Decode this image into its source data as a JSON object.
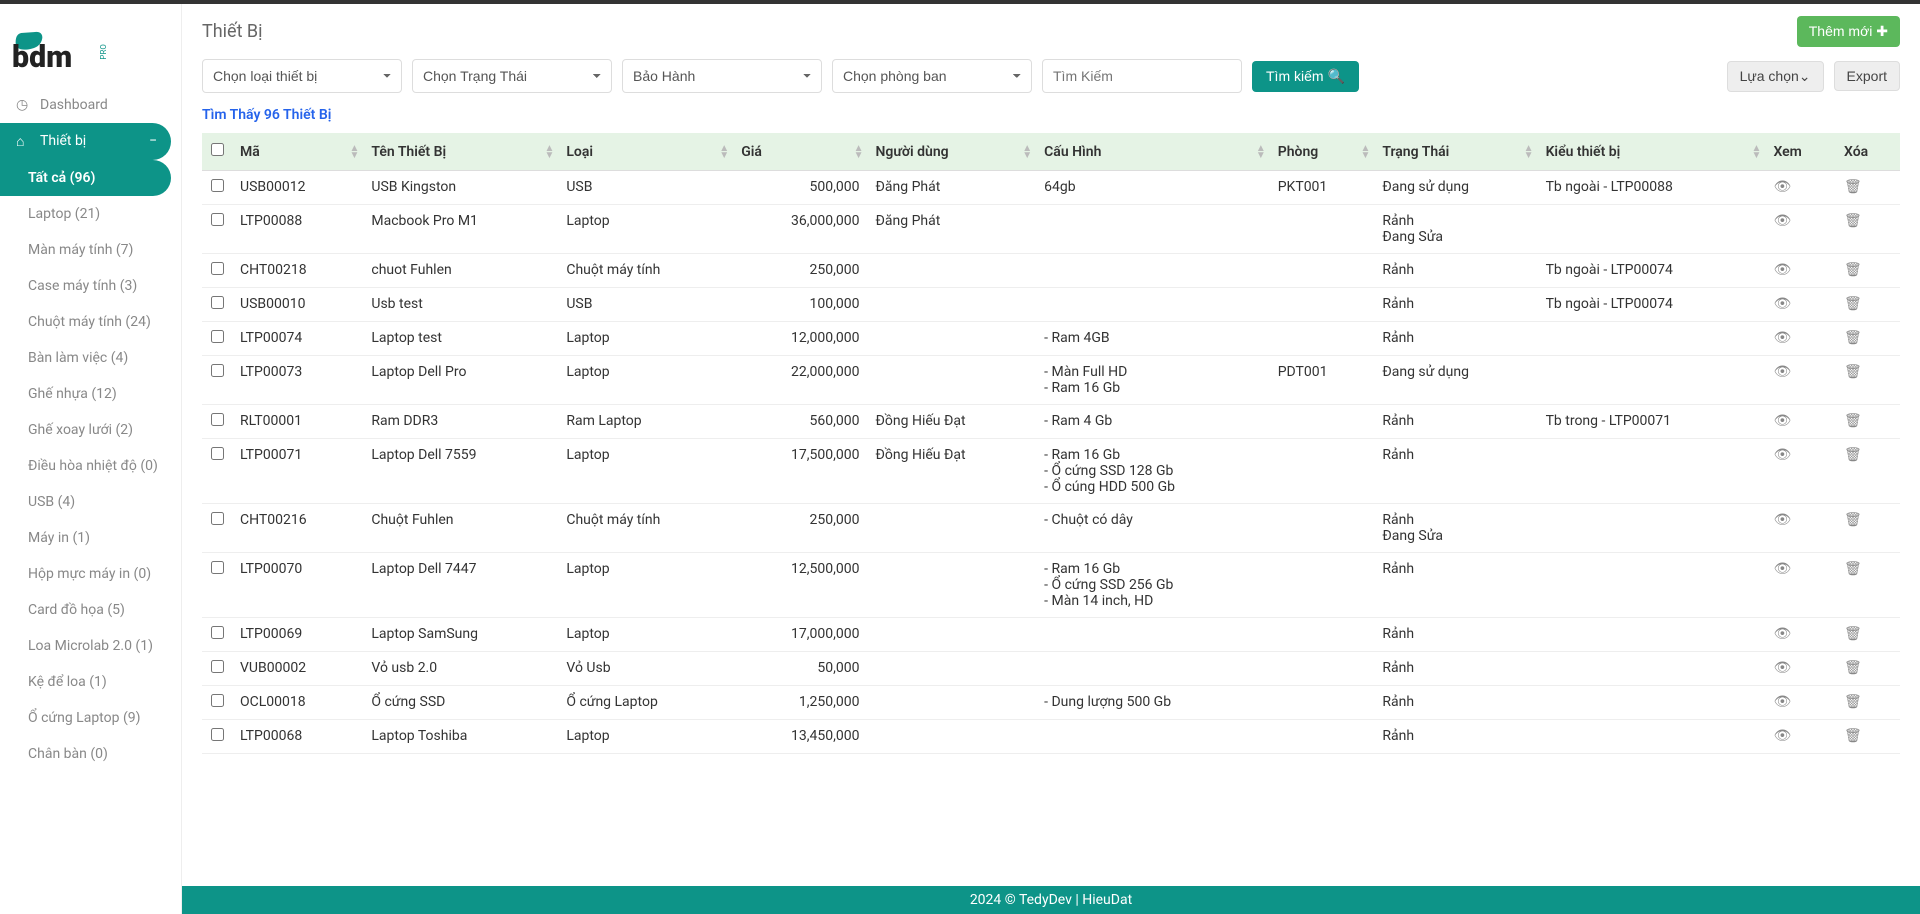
{
  "header": {
    "title": "Thiết Bị",
    "add_button": "Thêm mới "
  },
  "nav": {
    "dashboard": "Dashboard",
    "devices": "Thiết bị",
    "sub": [
      "Tất cả (96)",
      "Laptop (21)",
      "Màn máy tính (7)",
      "Case máy tính (3)",
      "Chuột máy tính (24)",
      "Bàn làm việc (4)",
      "Ghế nhựa (12)",
      "Ghế xoay lưới (2)",
      "Điều hòa nhiệt độ (0)",
      "USB (4)",
      "Máy in (1)",
      "Hộp mực máy in (0)",
      "Card đồ họa (5)",
      "Loa Microlab 2.0 (1)",
      "Kệ để loa (1)",
      "Ổ cứng Laptop (9)",
      "Chân bàn (0)"
    ]
  },
  "filters": {
    "type_placeholder": "Chọn loại thiết bị",
    "status_placeholder": "Chọn Trạng Thái",
    "warranty_placeholder": "Bảo Hành",
    "dept_placeholder": "Chọn phòng ban",
    "search_placeholder": "Tìm Kiếm",
    "search_btn": "Tìm kiếm ",
    "option_btn": "Lựa chọn",
    "export_btn": "Export"
  },
  "found_text": "Tìm Thấy 96 Thiết Bị",
  "columns": {
    "code": "Mã",
    "name": "Tên Thiết Bị",
    "type": "Loại",
    "price": "Giá",
    "user": "Người dùng",
    "config": "Cấu Hình",
    "room": "Phòng",
    "status": "Trạng Thái",
    "kind": "Kiểu thiết bị",
    "view": "Xem",
    "delete": "Xóa"
  },
  "rows": [
    {
      "code": "USB00012",
      "name": "USB Kingston",
      "type": "USB",
      "price": "500,000",
      "user": "Đăng Phát",
      "config": "64gb",
      "room": "PKT001",
      "status": "Đang sử dụng",
      "kind": "Tb ngoài - LTP00088"
    },
    {
      "code": "LTP00088",
      "name": "Macbook Pro M1",
      "type": "Laptop",
      "price": "36,000,000",
      "user": "Đăng Phát",
      "config": "",
      "room": "",
      "status": "Rảnh\nĐang Sửa",
      "kind": ""
    },
    {
      "code": "CHT00218",
      "name": "chuot Fuhlen",
      "type": "Chuột máy tính",
      "price": "250,000",
      "user": "",
      "config": "",
      "room": "",
      "status": "Rảnh",
      "kind": "Tb ngoài - LTP00074"
    },
    {
      "code": "USB00010",
      "name": "Usb test",
      "type": "USB",
      "price": "100,000",
      "user": "",
      "config": "",
      "room": "",
      "status": "Rảnh",
      "kind": "Tb ngoài - LTP00074"
    },
    {
      "code": "LTP00074",
      "name": "Laptop test",
      "type": "Laptop",
      "price": "12,000,000",
      "user": "",
      "config": "- Ram 4GB",
      "room": "",
      "status": "Rảnh",
      "kind": ""
    },
    {
      "code": "LTP00073",
      "name": "Laptop Dell Pro",
      "type": "Laptop",
      "price": "22,000,000",
      "user": "",
      "config": "- Màn Full HD\n- Ram 16 Gb",
      "room": "PDT001",
      "status": "Đang sử dụng",
      "kind": ""
    },
    {
      "code": "RLT00001",
      "name": "Ram DDR3",
      "type": "Ram Laptop",
      "price": "560,000",
      "user": "Đồng Hiếu Đạt",
      "config": "- Ram 4 Gb",
      "room": "",
      "status": "Rảnh",
      "kind": "Tb trong - LTP00071"
    },
    {
      "code": "LTP00071",
      "name": "Laptop Dell 7559",
      "type": "Laptop",
      "price": "17,500,000",
      "user": "Đồng Hiếu Đạt",
      "config": "- Ram 16 Gb\n- Ổ cứng SSD 128 Gb\n- Ổ cúng HDD 500 Gb",
      "room": "",
      "status": "Rảnh",
      "kind": ""
    },
    {
      "code": "CHT00216",
      "name": "Chuột Fuhlen",
      "type": "Chuột máy tính",
      "price": "250,000",
      "user": "",
      "config": "- Chuột có dây",
      "room": "",
      "status": "Rảnh\nĐang Sửa",
      "kind": ""
    },
    {
      "code": "LTP00070",
      "name": "Laptop Dell 7447",
      "type": "Laptop",
      "price": "12,500,000",
      "user": "",
      "config": "- Ram 16 Gb\n- Ổ cứng SSD 256 Gb\n- Màn 14 inch, HD",
      "room": "",
      "status": "Rảnh",
      "kind": ""
    },
    {
      "code": "LTP00069",
      "name": "Laptop SamSung",
      "type": "Laptop",
      "price": "17,000,000",
      "user": "",
      "config": "",
      "room": "",
      "status": "Rảnh",
      "kind": ""
    },
    {
      "code": "VUB00002",
      "name": "Vỏ usb 2.0",
      "type": "Vỏ Usb",
      "price": "50,000",
      "user": "",
      "config": "",
      "room": "",
      "status": "Rảnh",
      "kind": ""
    },
    {
      "code": "OCL00018",
      "name": "Ổ cứng SSD",
      "type": "Ổ cứng Laptop",
      "price": "1,250,000",
      "user": "",
      "config": "- Dung lượng 500 Gb",
      "room": "",
      "status": "Rảnh",
      "kind": ""
    },
    {
      "code": "LTP00068",
      "name": "Laptop Toshiba",
      "type": "Laptop",
      "price": "13,450,000",
      "user": "",
      "config": "",
      "room": "",
      "status": "Rảnh",
      "kind": ""
    }
  ],
  "footer": "2024 © TedyDev | HieuDat"
}
